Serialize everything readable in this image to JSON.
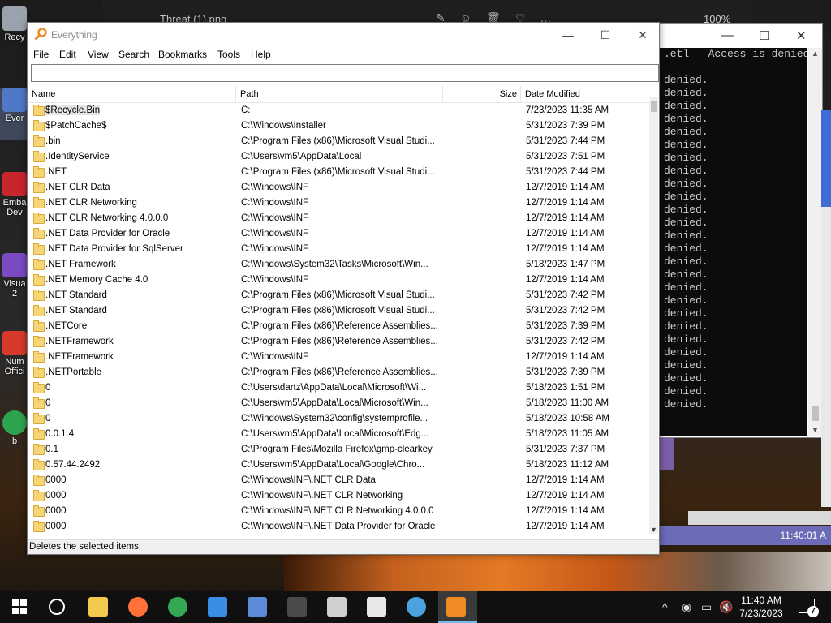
{
  "photos_window": {
    "title": "Threat (1).png",
    "zoom": "100%"
  },
  "desktop": {
    "icons": [
      {
        "label": "Recy",
        "icon": "recycle-bin-icon",
        "color": "#9aa3ad"
      },
      {
        "label": "Ever",
        "icon": "everything-icon",
        "color": "#4f79c7"
      },
      {
        "label": "Emba\nDev",
        "icon": "embarcadero-icon",
        "color": "#c8262c"
      },
      {
        "label": "Visua\n2",
        "icon": "visual-studio-icon",
        "color": "#7a4bc2"
      },
      {
        "label": "Num\nOffici",
        "icon": "numbers-icon",
        "color": "#d73a2a"
      },
      {
        "label": "b",
        "icon": "chrome-icon",
        "color": "#2ea44f"
      }
    ]
  },
  "console": {
    "lines": [
      ".etl - Access is denied",
      "denied.",
      "denied.",
      "denied.",
      "denied.",
      "denied.",
      "denied.",
      "denied.",
      "denied.",
      "denied.",
      "denied.",
      "denied.",
      "denied.",
      "denied.",
      "denied.",
      "denied.",
      "denied.",
      "denied.",
      "denied.",
      "denied.",
      "denied.",
      "denied.",
      "denied.",
      "denied.",
      "denied.",
      "denied.",
      "denied."
    ]
  },
  "clock_bar": {
    "time": "11:40:01 A"
  },
  "everything": {
    "title": "Everything",
    "menu": [
      "File",
      "Edit",
      "View",
      "Search",
      "Bookmarks",
      "Tools",
      "Help"
    ],
    "search": {
      "value": "",
      "placeholder": ""
    },
    "columns": {
      "name": "Name",
      "path": "Path",
      "size": "Size",
      "date": "Date Modified"
    },
    "rows": [
      {
        "name": "$Recycle.Bin",
        "path": "C:",
        "date": "7/23/2023 11:35 AM"
      },
      {
        "name": "$PatchCache$",
        "path": "C:\\Windows\\Installer",
        "date": "5/31/2023 7:39 PM"
      },
      {
        "name": ".bin",
        "path": "C:\\Program Files (x86)\\Microsoft Visual Studi...",
        "date": "5/31/2023 7:44 PM"
      },
      {
        "name": ".IdentityService",
        "path": "C:\\Users\\vm5\\AppData\\Local",
        "date": "5/31/2023 7:51 PM"
      },
      {
        "name": ".NET",
        "path": "C:\\Program Files (x86)\\Microsoft Visual Studi...",
        "date": "5/31/2023 7:44 PM"
      },
      {
        "name": ".NET CLR Data",
        "path": "C:\\Windows\\INF",
        "date": "12/7/2019 1:14 AM"
      },
      {
        "name": ".NET CLR Networking",
        "path": "C:\\Windows\\INF",
        "date": "12/7/2019 1:14 AM"
      },
      {
        "name": ".NET CLR Networking 4.0.0.0",
        "path": "C:\\Windows\\INF",
        "date": "12/7/2019 1:14 AM"
      },
      {
        "name": ".NET Data Provider for Oracle",
        "path": "C:\\Windows\\INF",
        "date": "12/7/2019 1:14 AM"
      },
      {
        "name": ".NET Data Provider for SqlServer",
        "path": "C:\\Windows\\INF",
        "date": "12/7/2019 1:14 AM"
      },
      {
        "name": ".NET Framework",
        "path": "C:\\Windows\\System32\\Tasks\\Microsoft\\Win...",
        "date": "5/18/2023 1:47 PM"
      },
      {
        "name": ".NET Memory Cache 4.0",
        "path": "C:\\Windows\\INF",
        "date": "12/7/2019 1:14 AM"
      },
      {
        "name": ".NET Standard",
        "path": "C:\\Program Files (x86)\\Microsoft Visual Studi...",
        "date": "5/31/2023 7:42 PM"
      },
      {
        "name": ".NET Standard",
        "path": "C:\\Program Files (x86)\\Microsoft Visual Studi...",
        "date": "5/31/2023 7:42 PM"
      },
      {
        "name": ".NETCore",
        "path": "C:\\Program Files (x86)\\Reference Assemblies...",
        "date": "5/31/2023 7:39 PM"
      },
      {
        "name": ".NETFramework",
        "path": "C:\\Program Files (x86)\\Reference Assemblies...",
        "date": "5/31/2023 7:42 PM"
      },
      {
        "name": ".NETFramework",
        "path": "C:\\Windows\\INF",
        "date": "12/7/2019 1:14 AM"
      },
      {
        "name": ".NETPortable",
        "path": "C:\\Program Files (x86)\\Reference Assemblies...",
        "date": "5/31/2023 7:39 PM"
      },
      {
        "name": "0",
        "path": "C:\\Users\\dartz\\AppData\\Local\\Microsoft\\Wi...",
        "date": "5/18/2023 1:51 PM"
      },
      {
        "name": "0",
        "path": "C:\\Users\\vm5\\AppData\\Local\\Microsoft\\Win...",
        "date": "5/18/2023 11:00 AM"
      },
      {
        "name": "0",
        "path": "C:\\Windows\\System32\\config\\systemprofile...",
        "date": "5/18/2023 10:58 AM"
      },
      {
        "name": "0.0.1.4",
        "path": "C:\\Users\\vm5\\AppData\\Local\\Microsoft\\Edg...",
        "date": "5/18/2023 11:05 AM"
      },
      {
        "name": "0.1",
        "path": "C:\\Program Files\\Mozilla Firefox\\gmp-clearkey",
        "date": "5/31/2023 7:37 PM"
      },
      {
        "name": "0.57.44.2492",
        "path": "C:\\Users\\vm5\\AppData\\Local\\Google\\Chro...",
        "date": "5/18/2023 11:12 AM"
      },
      {
        "name": "0000",
        "path": "C:\\Windows\\INF\\.NET CLR Data",
        "date": "12/7/2019 1:14 AM"
      },
      {
        "name": "0000",
        "path": "C:\\Windows\\INF\\.NET CLR Networking",
        "date": "12/7/2019 1:14 AM"
      },
      {
        "name": "0000",
        "path": "C:\\Windows\\INF\\.NET CLR Networking 4.0.0.0",
        "date": "12/7/2019 1:14 AM"
      },
      {
        "name": "0000",
        "path": "C:\\Windows\\INF\\.NET Data Provider for Oracle",
        "date": "12/7/2019 1:14 AM"
      }
    ],
    "status": "Deletes the selected items."
  },
  "taskbar": {
    "items": [
      {
        "name": "search-icon",
        "color": "#ffffff"
      },
      {
        "name": "file-explorer-icon",
        "color": "#f2c94c"
      },
      {
        "name": "firefox-icon",
        "color": "#ff7139"
      },
      {
        "name": "chrome-icon",
        "color": "#34a853"
      },
      {
        "name": "photos-icon",
        "color": "#3a8ee6"
      },
      {
        "name": "remote-desktop-icon",
        "color": "#5c8ad6"
      },
      {
        "name": "terminal-icon",
        "color": "#4a4a4a"
      },
      {
        "name": "package-icon",
        "color": "#d0d0d0"
      },
      {
        "name": "7zip-icon",
        "color": "#e8e8e8"
      },
      {
        "name": "disc-burner-icon",
        "color": "#4aa3df"
      },
      {
        "name": "everything-icon",
        "color": "#f08a24"
      }
    ],
    "time": "11:40 AM",
    "date": "7/23/2023",
    "notifications": "7"
  }
}
